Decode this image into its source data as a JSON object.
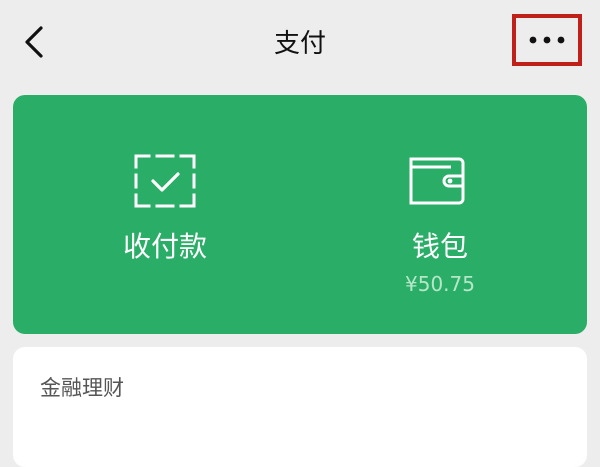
{
  "header": {
    "title": "支付",
    "back_icon": "chevron-left-icon",
    "more_icon": "more-dots-icon",
    "highlight_color": "#c0201a"
  },
  "pay_card": {
    "background_color": "#2aae67",
    "items": [
      {
        "label": "收付款",
        "icon": "scan-receive-icon"
      },
      {
        "label": "钱包",
        "icon": "wallet-icon",
        "balance": "¥50.75"
      }
    ]
  },
  "finance": {
    "title": "金融理财"
  }
}
